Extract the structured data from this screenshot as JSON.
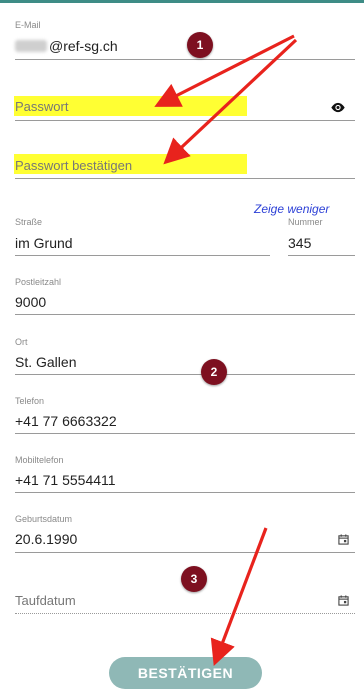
{
  "form": {
    "email": {
      "label": "E-Mail",
      "value_suffix": "@ref-sg.ch"
    },
    "password": {
      "placeholder": "Passwort"
    },
    "password_confirm": {
      "placeholder": "Passwort bestätigen"
    },
    "toggle_link": "Zeige weniger",
    "street": {
      "label": "Straße",
      "value": "im Grund"
    },
    "number": {
      "label": "Nummer",
      "value": "345"
    },
    "zip": {
      "label": "Postleitzahl",
      "value": "9000"
    },
    "city": {
      "label": "Ort",
      "value": "St. Gallen"
    },
    "phone": {
      "label": "Telefon",
      "value": "+41 77 6663322"
    },
    "mobile": {
      "label": "Mobiltelefon",
      "value": "+41 71 5554411"
    },
    "birthdate": {
      "label": "Geburtsdatum",
      "value": "20.6.1990"
    },
    "baptism": {
      "placeholder": "Taufdatum"
    },
    "submit_label": "BESTÄTIGEN"
  },
  "annotations": {
    "badges": [
      "1",
      "2",
      "3"
    ],
    "arrow_color": "#e8231d",
    "badge_color": "#7d1020",
    "highlight_color": "#ffff33"
  },
  "colors": {
    "accent": "#3e8c86",
    "button": "#8fb8b6",
    "link": "#2b3fd6"
  }
}
